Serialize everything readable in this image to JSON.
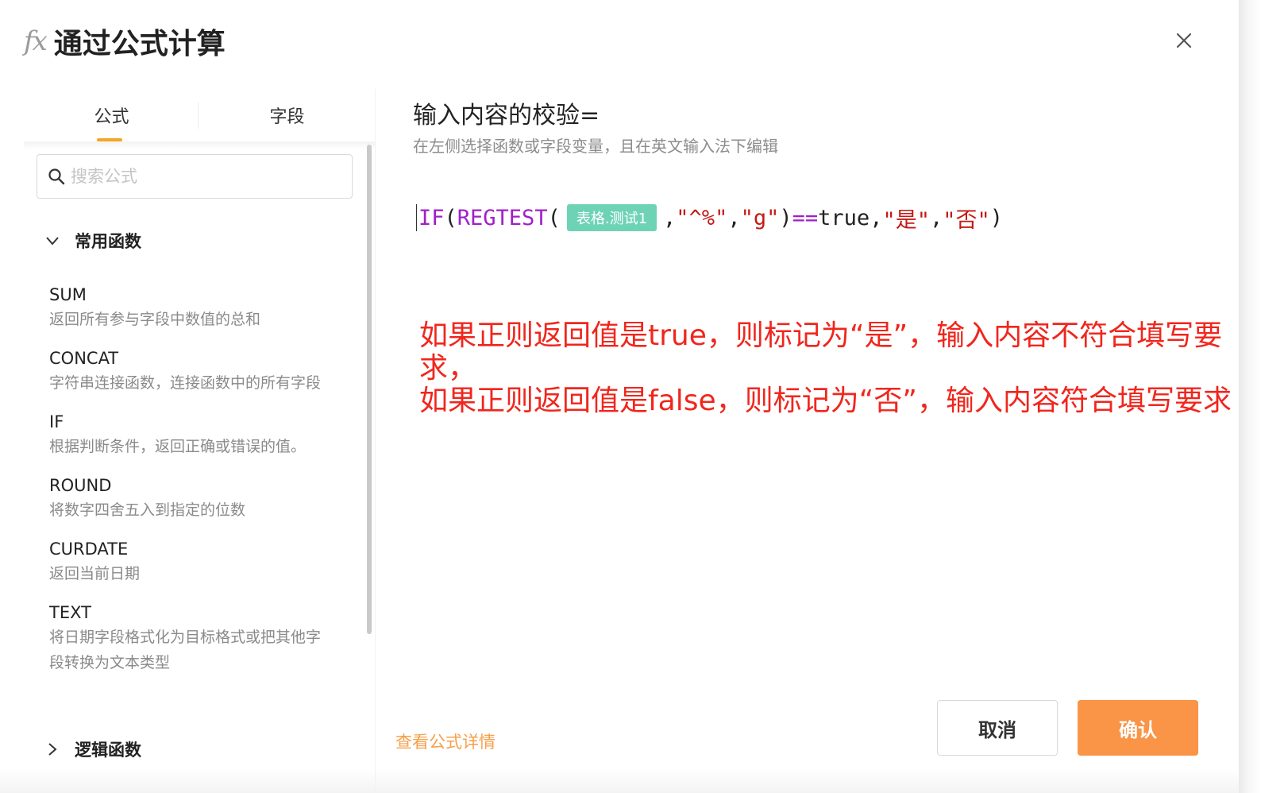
{
  "dialog": {
    "fx_label": "fx",
    "title": "通过公式计算"
  },
  "tabs": [
    {
      "label": "公式",
      "active": true
    },
    {
      "label": "字段",
      "active": false
    }
  ],
  "search": {
    "placeholder": "搜索公式",
    "value": ""
  },
  "groups": {
    "common": {
      "title": "常用函数",
      "expanded": true
    },
    "logic": {
      "title": "逻辑函数",
      "expanded": false
    }
  },
  "functions": [
    {
      "name": "SUM",
      "desc": "返回所有参与字段中数值的总和"
    },
    {
      "name": "CONCAT",
      "desc": "字符串连接函数，连接函数中的所有字段"
    },
    {
      "name": "IF",
      "desc": "根据判断条件，返回正确或错误的值。"
    },
    {
      "name": "ROUND",
      "desc": "将数字四舍五入到指定的位数"
    },
    {
      "name": "CURDATE",
      "desc": "返回当前日期"
    },
    {
      "name": "TEXT",
      "desc": "将日期字段格式化为目标格式或把其他字段转换为文本类型"
    }
  ],
  "formula": {
    "title": "输入内容的校验=",
    "hint": "在左侧选择函数或字段变量，且在英文输入法下编辑",
    "tokens": {
      "if": "IF",
      "open1": "(",
      "regtest": "REGTEST",
      "open2": "(",
      "field": "表格.测试1",
      "comma1": ",",
      "pattern": "\"^%\"",
      "comma2": ",",
      "flag": "\"g\"",
      "close1": ")",
      "eq": "==",
      "true_kw": "true",
      "comma3": ",",
      "yes": "\"是\"",
      "comma4": ",",
      "no": "\"否\"",
      "close2": ")"
    }
  },
  "annotation": {
    "line1": "如果正则返回值是true，则标记为“是”，输入内容不符合填写要求，",
    "line2": "如果正则返回值是false，则标记为“否”，输入内容符合填写要求"
  },
  "footer": {
    "details_link": "查看公式详情",
    "cancel_label": "取消",
    "confirm_label": "确认"
  },
  "colors": {
    "accent": "#fa9446",
    "tab_indicator": "#f5a623",
    "field_tag": "#6ed3b5",
    "function_token": "#a020c8",
    "string_token": "#c41a16",
    "annotation": "#f0261d"
  }
}
